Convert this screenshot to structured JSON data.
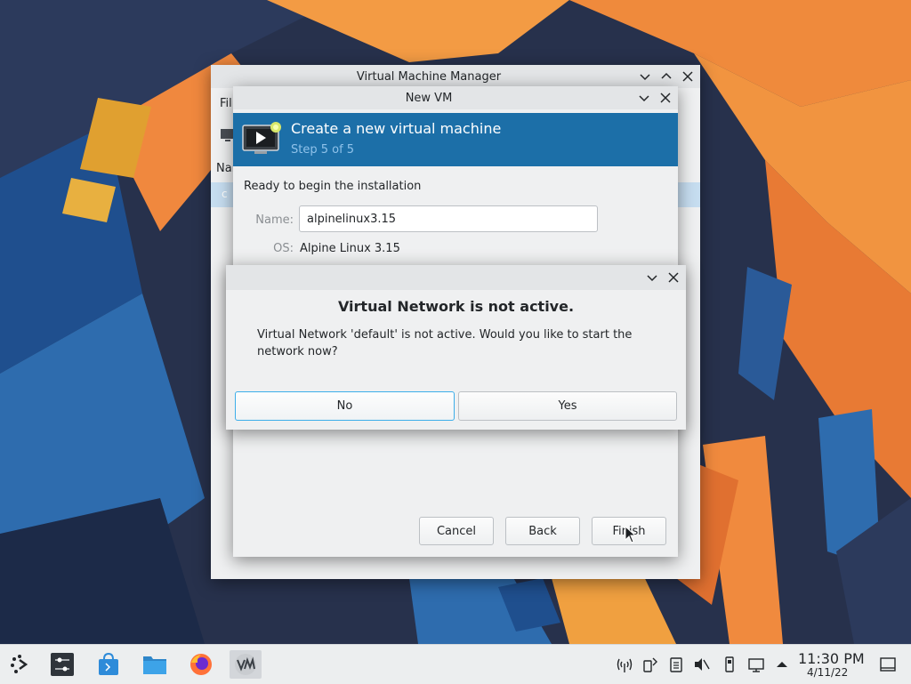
{
  "desktop": {
    "colors": {
      "orange": "#f0883e",
      "blue": "#2e6cae",
      "dark": "#27314c"
    }
  },
  "vmm_window": {
    "title": "Virtual Machine Manager",
    "menu_file_partial": "Fil",
    "column_name_partial": "Nar",
    "row_partial": "c"
  },
  "new_vm_window": {
    "title": "New VM",
    "banner_title": "Create a new virtual machine",
    "banner_step": "Step 5 of 5",
    "ready_text": "Ready to begin the installation",
    "name_label": "Name:",
    "name_value": "alpinelinux3.15",
    "os_label": "OS:",
    "os_value": "Alpine Linux 3.15",
    "buttons": {
      "cancel": "Cancel",
      "back": "Back",
      "finish": "Finish"
    }
  },
  "dialog": {
    "heading": "Virtual Network is not active.",
    "message": "Virtual Network 'default' is not active. Would you like to start the network now?",
    "buttons": {
      "no": "No",
      "yes": "Yes"
    }
  },
  "taskbar": {
    "apps": [
      "app-launcher-icon",
      "system-settings-icon",
      "discover-store-icon",
      "file-manager-icon",
      "firefox-icon",
      "virt-manager-icon"
    ],
    "tray": [
      "network-monitor-icon",
      "kde-connect-icon",
      "clipboard-icon",
      "volume-muted-icon",
      "usb-device-icon",
      "display-icon",
      "tray-expand-icon"
    ],
    "clock_time": "11:30 PM",
    "clock_date": "4/11/22"
  }
}
